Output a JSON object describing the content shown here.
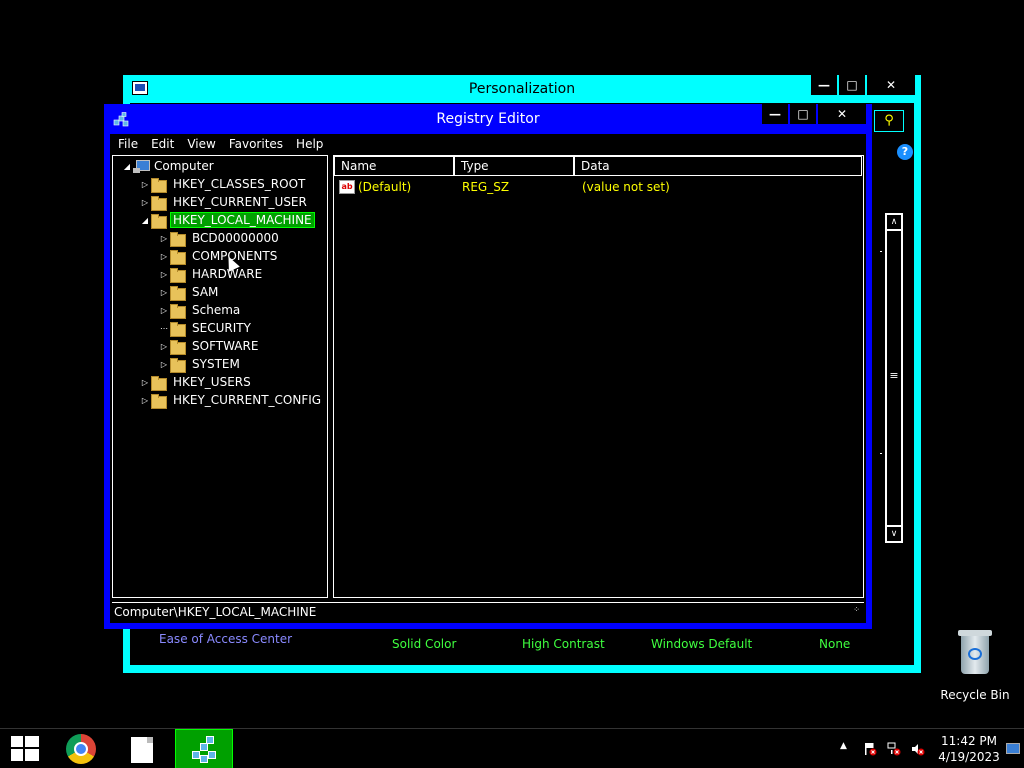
{
  "personalization": {
    "title": "Personalization",
    "ease_of_access": "Ease of Access Center",
    "theme_links": [
      "Solid Color",
      "High Contrast",
      "Windows Default",
      "None"
    ]
  },
  "registry": {
    "title": "Registry Editor",
    "menu": [
      "File",
      "Edit",
      "View",
      "Favorites",
      "Help"
    ],
    "tree": {
      "root": "Computer",
      "hives": [
        "HKEY_CLASSES_ROOT",
        "HKEY_CURRENT_USER",
        "HKEY_LOCAL_MACHINE",
        "HKEY_USERS",
        "HKEY_CURRENT_CONFIG"
      ],
      "hklm_children": [
        "BCD00000000",
        "COMPONENTS",
        "HARDWARE",
        "SAM",
        "Schema",
        "SECURITY",
        "SOFTWARE",
        "SYSTEM"
      ]
    },
    "columns": [
      "Name",
      "Type",
      "Data"
    ],
    "values": [
      {
        "name": "(Default)",
        "type": "REG_SZ",
        "data": "(value not set)"
      }
    ],
    "status": "Computer\\HKEY_LOCAL_MACHINE"
  },
  "desktop": {
    "recycle_bin": "Recycle Bin"
  },
  "taskbar": {
    "time": "11:42 PM",
    "date": "4/19/2023"
  },
  "colors": {
    "highlight": "#00ffff",
    "window": "#0000ff",
    "selection": "#00a000",
    "value_text": "#ffff00"
  }
}
